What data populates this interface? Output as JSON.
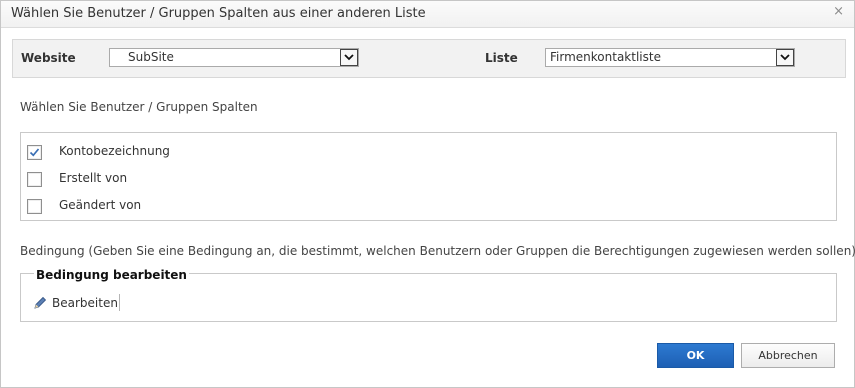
{
  "dialog": {
    "title": "Wählen Sie Benutzer / Gruppen Spalten aus einer anderen Liste",
    "close_glyph": "×"
  },
  "filters": {
    "website_label": "Website",
    "website_value": "SubSite",
    "list_label": "Liste",
    "list_value": "Firmenkontaktliste"
  },
  "columns": {
    "heading": "Wählen Sie Benutzer / Gruppen Spalten",
    "items": [
      {
        "label": "Kontobezeichnung",
        "checked": true
      },
      {
        "label": "Erstellt von",
        "checked": false
      },
      {
        "label": "Geändert von",
        "checked": false
      }
    ]
  },
  "condition": {
    "description": "Bedingung (Geben Sie eine Bedingung an, die bestimmt, welchen Benutzern oder Gruppen die Berechtigungen zugewiesen werden sollen)",
    "box_title": "Bedingung bearbeiten",
    "edit_label": "Bearbeiten"
  },
  "buttons": {
    "ok": "OK",
    "cancel": "Abbrechen"
  },
  "icons": {
    "close": "close-icon",
    "dropdown": "chevron-down-icon",
    "edit": "pencil-icon",
    "check": "checkmark-icon"
  },
  "colors": {
    "ok_button": "#1d5fb4",
    "header_bg": "#f2f2f2"
  }
}
